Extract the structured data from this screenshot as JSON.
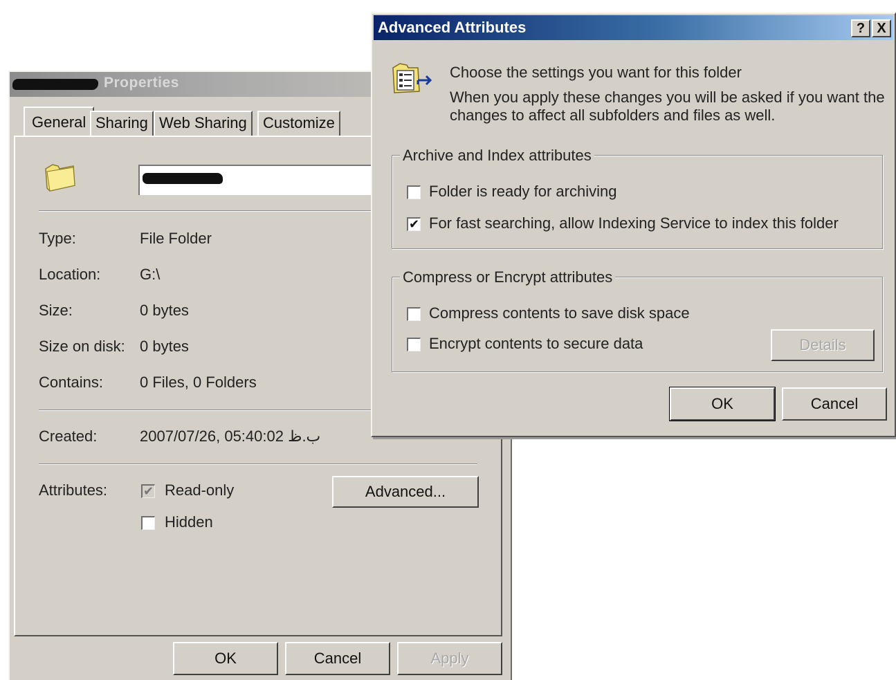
{
  "properties": {
    "title_suffix": "Properties",
    "tabs": [
      {
        "label": "General",
        "active": true
      },
      {
        "label": "Sharing"
      },
      {
        "label": "Web Sharing"
      },
      {
        "label": "Customize"
      }
    ],
    "fields": {
      "type": {
        "label": "Type:",
        "value": "File Folder"
      },
      "location": {
        "label": "Location:",
        "value": "G:\\"
      },
      "size": {
        "label": "Size:",
        "value": "0 bytes"
      },
      "size_on_disk": {
        "label": "Size on disk:",
        "value": "0 bytes"
      },
      "contains": {
        "label": "Contains:",
        "value": "0 Files, 0 Folders"
      },
      "created": {
        "label": "Created:",
        "value": "2007/07/26, 05:40:02 ب.ظ"
      }
    },
    "attributes": {
      "label": "Attributes:",
      "read_only": {
        "label": "Read-only",
        "checked": true,
        "indeterminate": true
      },
      "hidden": {
        "label": "Hidden",
        "checked": false
      },
      "advanced_button": "Advanced..."
    },
    "buttons": {
      "ok": "OK",
      "cancel": "Cancel",
      "apply": "Apply"
    }
  },
  "advanced": {
    "title": "Advanced Attributes",
    "help_glyph": "?",
    "close_glyph": "X",
    "intro": "Choose the settings you want for this folder",
    "description_line1": "When you apply these changes you will be asked if you want the",
    "description_line2": "changes to affect all subfolders and files as well.",
    "archive_group": {
      "legend": "Archive and Index attributes",
      "archiving": {
        "label": "Folder is ready for archiving",
        "checked": false
      },
      "indexing": {
        "label": "For fast searching, allow Indexing Service to index this folder",
        "checked": true
      }
    },
    "compress_group": {
      "legend": "Compress or Encrypt attributes",
      "compress": {
        "label": "Compress contents to save disk space",
        "checked": false
      },
      "encrypt": {
        "label": "Encrypt contents to secure data",
        "checked": false
      },
      "details_button": "Details"
    },
    "buttons": {
      "ok": "OK",
      "cancel": "Cancel"
    },
    "check_glyph": "✔"
  },
  "colors": {
    "dialog_face": "#d4d0c8",
    "active_title_start": "#0a246a",
    "active_title_end": "#a6caf0",
    "inactive_title": "#a9a9a9",
    "folder_yellow": "#f3e27a"
  }
}
